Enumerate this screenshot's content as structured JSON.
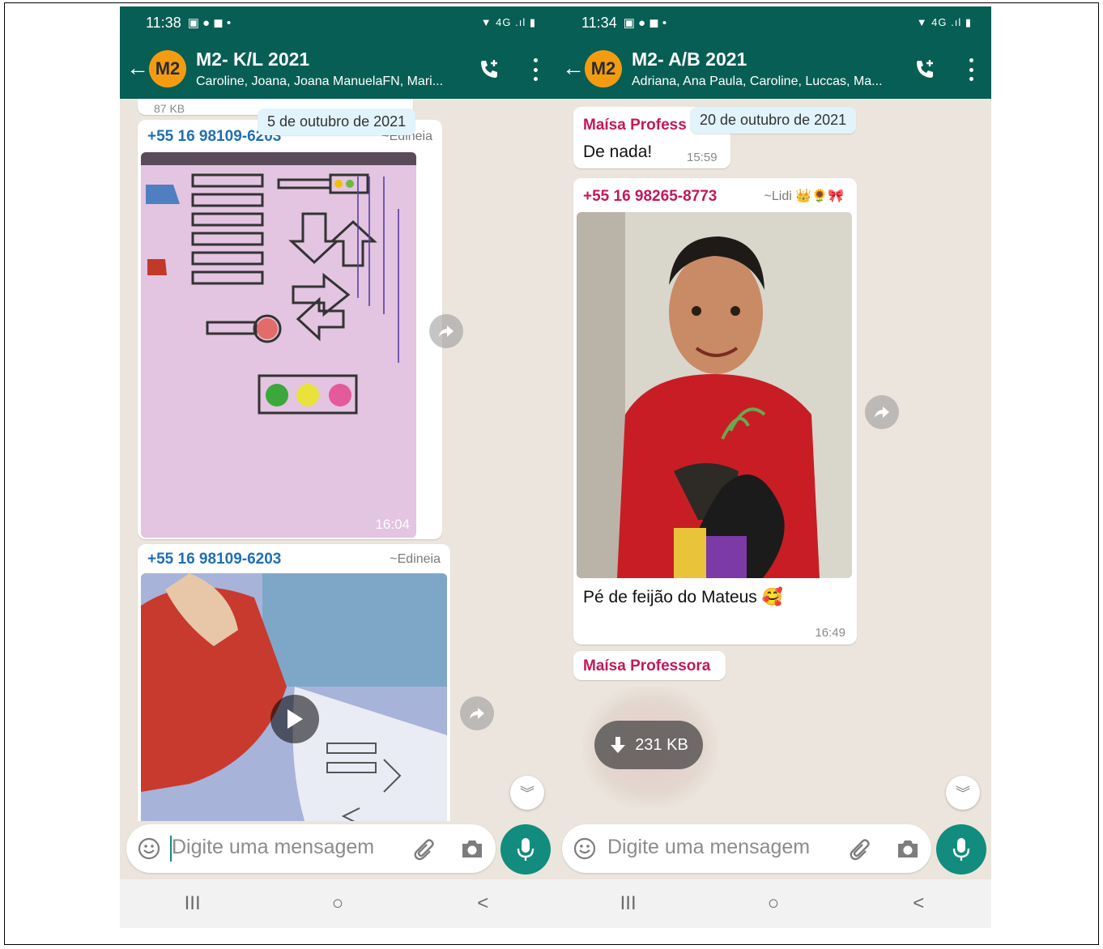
{
  "colors": {
    "header": "#075e54",
    "accent": "#128c7e",
    "chat_bg": "#ece5dd",
    "date_chip": "#e1f3fb",
    "avatar": "#f39c12",
    "sender_blue": "#1f6fb5",
    "sender_pink": "#c2185b"
  },
  "left": {
    "status": {
      "time": "11:38",
      "icons": "▣ ● ◼ •",
      "right": "▼ 4G .ıl ▮"
    },
    "header": {
      "avatar": "M2",
      "title": "M2- K/L 2021",
      "subtitle": "Caroline, Joana, Joana ManuelaFN, Mari..."
    },
    "date_chip": "5 de outubro de 2021",
    "prev_size": "87 KB",
    "msg1": {
      "sender": "+55 16 98109-6203",
      "alias": "~Edineia",
      "time": "16:04"
    },
    "msg2": {
      "sender": "+55 16 98109-6203",
      "alias": "~Edineia"
    },
    "input_placeholder": "Digite uma mensagem"
  },
  "right": {
    "status": {
      "time": "11:34",
      "icons": "▣ ● ◼ •",
      "right": "▼ 4G .ıl ▮"
    },
    "header": {
      "avatar": "M2",
      "title": "M2- A/B 2021",
      "subtitle": "Adriana, Ana Paula, Caroline, Luccas, Ma..."
    },
    "date_chip": "20 de outubro de 2021",
    "msg0": {
      "sender": "Maísa Profess",
      "text": "De nada!",
      "time": "15:59"
    },
    "msg1": {
      "sender": "+55 16 98265-8773",
      "alias": "~Lidi 👑🌻🎀",
      "caption": "Pé de feijão do Mateus 🥰",
      "time": "16:49"
    },
    "msg2": {
      "sender": "Maísa Professora",
      "download_size": "231 KB"
    },
    "input_placeholder": "Digite uma mensagem"
  },
  "nav": {
    "recents": "III",
    "home": "○",
    "back": "<"
  }
}
